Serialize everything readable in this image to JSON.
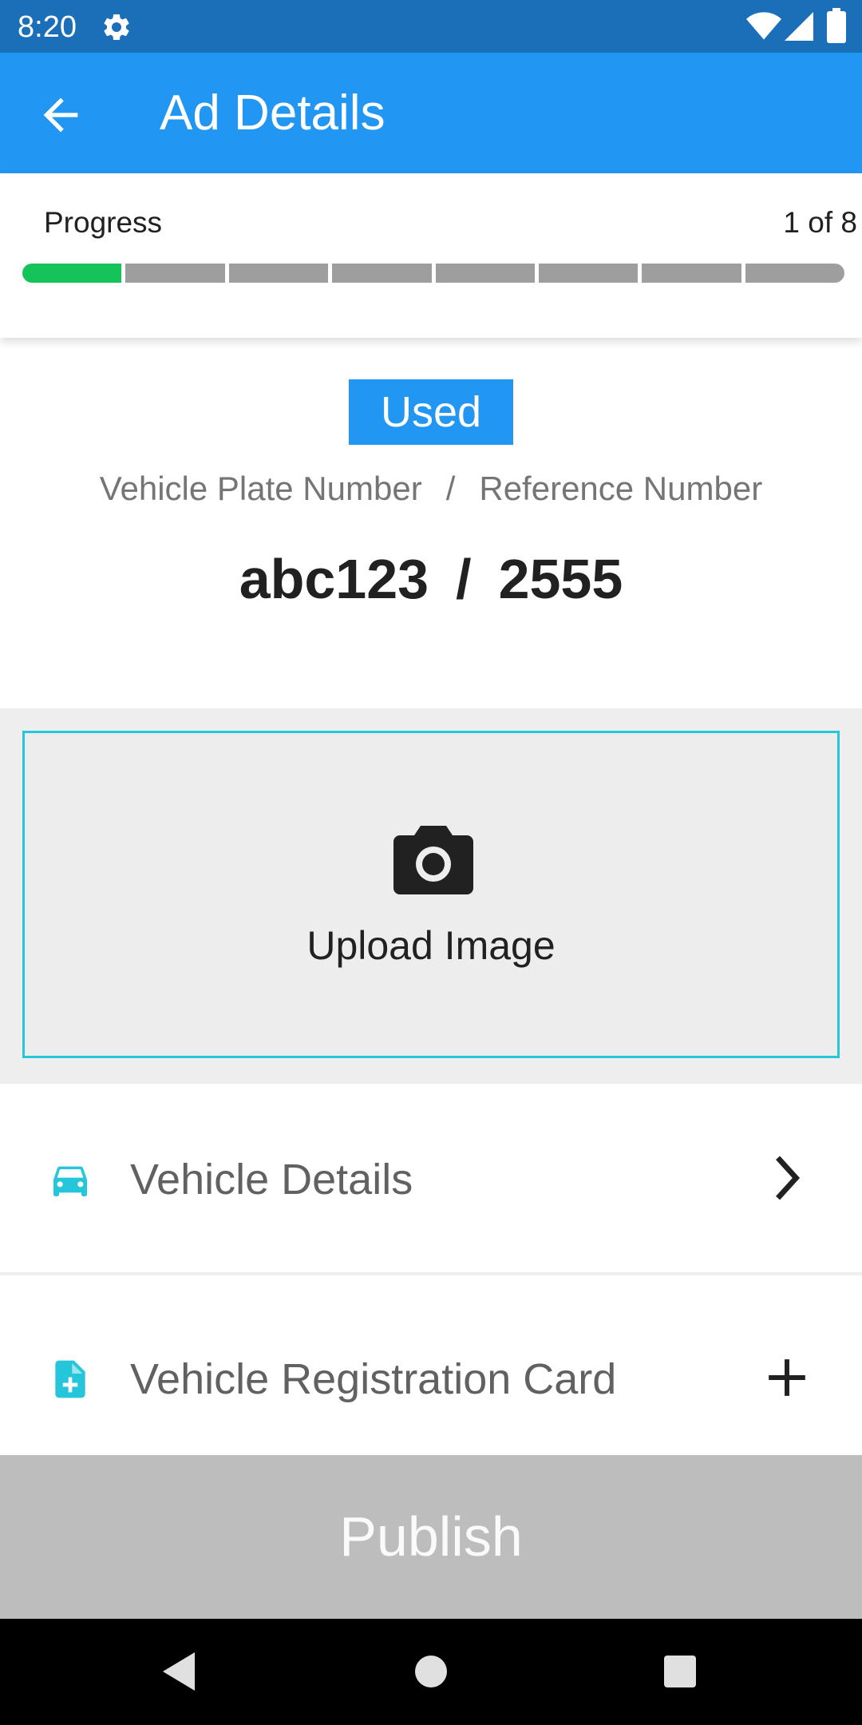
{
  "status_bar": {
    "time": "8:20",
    "icons": [
      "gear-icon",
      "wifi-icon",
      "signal-icon",
      "battery-icon"
    ]
  },
  "app_bar": {
    "title": "Ad Details",
    "back_icon": "arrow-back-icon",
    "color": "#2196f3"
  },
  "progress": {
    "label": "Progress",
    "count_text": "1 of 8",
    "completed_steps": 1,
    "total_steps": 8,
    "done_color": "#14c45a",
    "todo_color": "#9e9e9e"
  },
  "vehicle": {
    "condition_badge": "Used",
    "plate_label": "Vehicle Plate Number",
    "separator": "/",
    "reference_label": "Reference Number",
    "plate_value": "abc123",
    "reference_value": "2555"
  },
  "upload": {
    "icon": "camera-icon",
    "label": "Upload Image",
    "border_color": "#26c6da"
  },
  "sections": [
    {
      "label": "Vehicle Details",
      "icon": "car-icon",
      "action_icon": "chevron-right-icon"
    },
    {
      "label": "Vehicle Registration Card",
      "icon": "file-add-icon",
      "action_icon": "plus-icon"
    }
  ],
  "accent_color": "#26c6da",
  "publish": {
    "label": "Publish",
    "enabled": false
  },
  "nav_bar": {
    "buttons": [
      "nav-back-icon",
      "nav-home-icon",
      "nav-recents-icon"
    ]
  }
}
